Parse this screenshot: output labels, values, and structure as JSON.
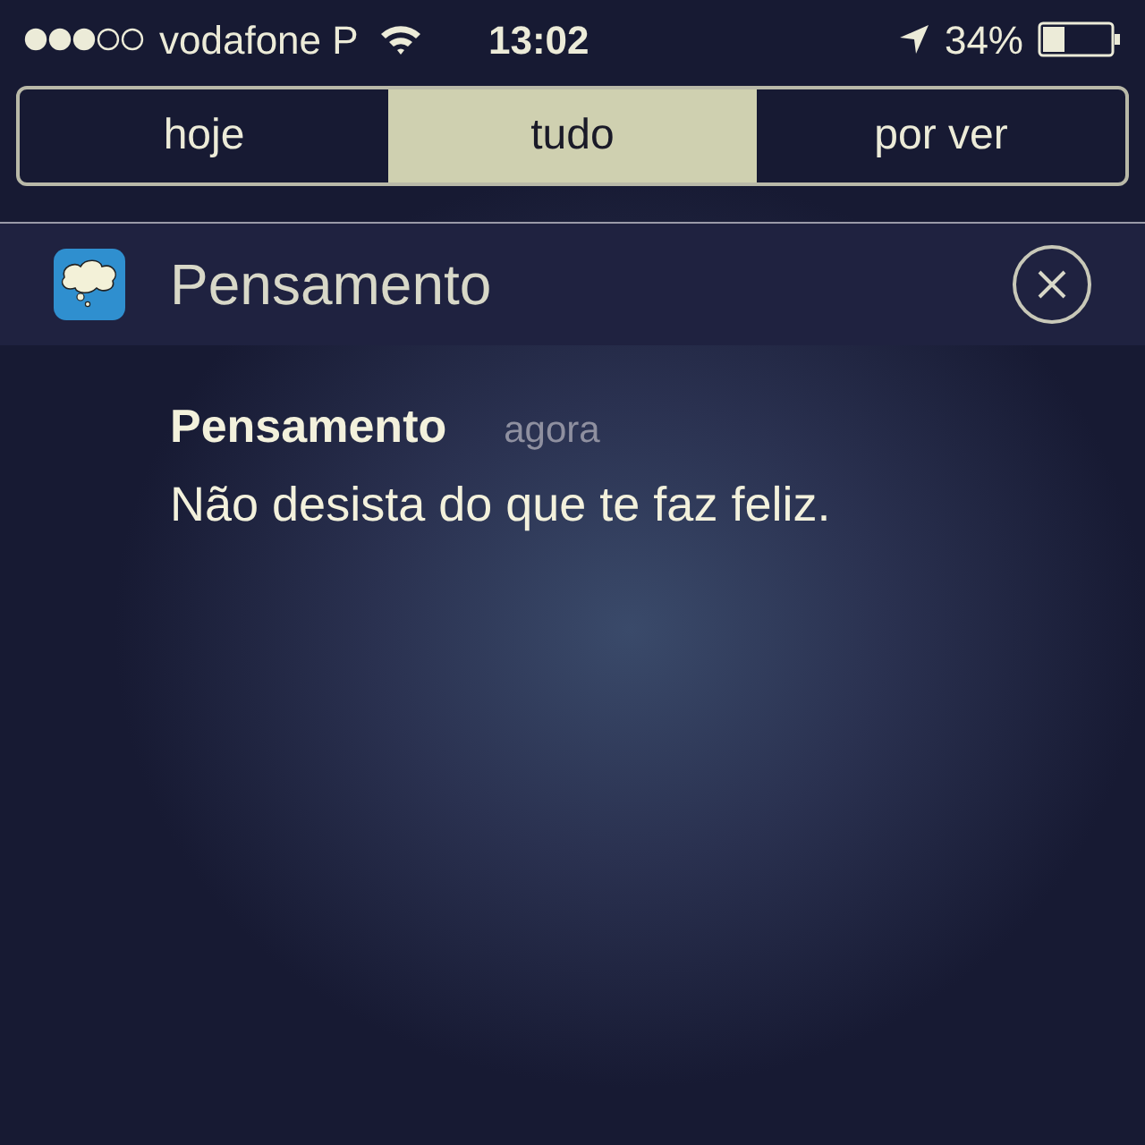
{
  "status_bar": {
    "carrier": "vodafone P",
    "time": "13:02",
    "battery": "34%"
  },
  "tabs": [
    {
      "label": "hoje",
      "selected": false
    },
    {
      "label": "tudo",
      "selected": true
    },
    {
      "label": "por ver",
      "selected": false
    }
  ],
  "section": {
    "title": "Pensamento"
  },
  "notifications": [
    {
      "title": "Pensamento",
      "time": "agora",
      "message": "Não desista do que te faz feliz."
    }
  ]
}
